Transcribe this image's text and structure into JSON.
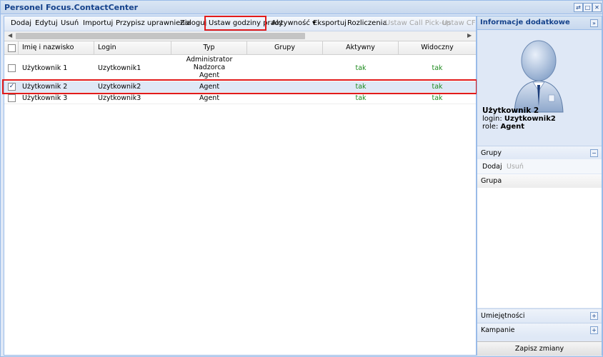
{
  "window": {
    "title": "Personel Focus.ContactCenter"
  },
  "toolbar": {
    "dodaj": "Dodaj",
    "edytuj": "Edytuj",
    "usun": "Usuń",
    "importuj": "Importuj",
    "przypisz": "Przypisz uprawnienia",
    "zaloguj": "Zaloguj",
    "ustaw_godziny": "Ustaw godziny pracy",
    "aktywnosc": "Aktywność ▾",
    "eksportuj": "Eksportuj",
    "rozliczenia": "Rozliczenia",
    "ustaw_pickup": "Ustaw Call Pick-up",
    "ustaw_cf": "Ustaw CF"
  },
  "grid": {
    "columns": [
      "Imię i nazwisko",
      "Login",
      "Typ",
      "Grupy",
      "Aktywny",
      "Widoczny"
    ],
    "rows": [
      {
        "name": "Użytkownik 1",
        "login": "Uzytkownik1",
        "typ": [
          "Administrator",
          "Nadzorca",
          "Agent"
        ],
        "grupy": "",
        "aktywny": "tak",
        "widoczny": "tak",
        "checked": false
      },
      {
        "name": "Użytkownik 2",
        "login": "Uzytkownik2",
        "typ": [
          "Agent"
        ],
        "grupy": "",
        "aktywny": "tak",
        "widoczny": "tak",
        "checked": true
      },
      {
        "name": "Użytkownik 3",
        "login": "Uzytkownik3",
        "typ": [
          "Agent"
        ],
        "grupy": "",
        "aktywny": "tak",
        "widoczny": "tak",
        "checked": false
      }
    ]
  },
  "info": {
    "title": "Informacje dodatkowe",
    "user_name": "Użytkownik 2",
    "login_label": "login:",
    "login_value": "Uzytkownik2",
    "role_label": "role:",
    "role_value": "Agent"
  },
  "groups": {
    "title": "Grupy",
    "add": "Dodaj",
    "remove": "Usuń",
    "column": "Grupa"
  },
  "sections": {
    "skills": "Umiejętności",
    "campaigns": "Kampanie"
  },
  "save": "Zapisz zmiany",
  "colors": {
    "highlight": "#e21b1b",
    "accent": "#15428b",
    "green": "#1e8a1e",
    "selected_row": "#dfe8f6"
  }
}
